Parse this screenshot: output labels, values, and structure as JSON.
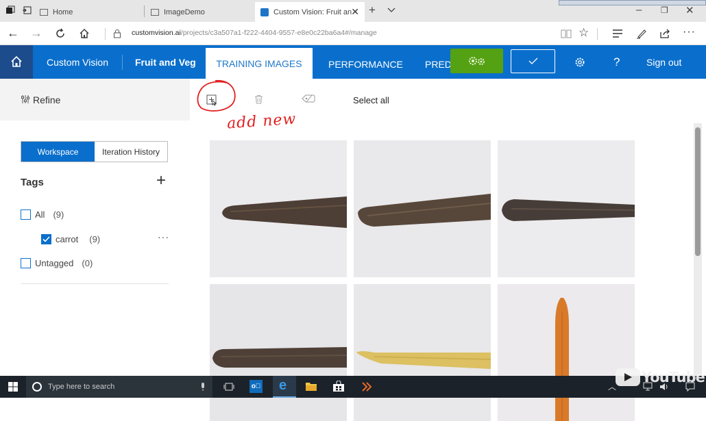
{
  "browser": {
    "tabs": [
      {
        "label": "Home",
        "active": false
      },
      {
        "label": "ImageDemo",
        "active": false
      },
      {
        "label": "Custom Vision: Fruit an",
        "active": true
      }
    ],
    "url_host": "customvision.ai",
    "url_path": "/projects/c3a507a1-f222-4404-9557-e8e0c22ba6a4#/manage"
  },
  "header": {
    "app_name": "Custom Vision",
    "project_name": "Fruit and Veg",
    "tabs": [
      "TRAINING IMAGES",
      "PERFORMANCE",
      "PREDI"
    ],
    "sign_out": "Sign out",
    "accent": "#0a6fcc",
    "train_color": "#55a114"
  },
  "sidebar": {
    "refine_label": "Refine",
    "seg_workspace": "Workspace",
    "seg_history": "Iteration History",
    "tags_title": "Tags",
    "tags": [
      {
        "label": "All",
        "count": "(9)",
        "checked": false
      },
      {
        "label": "carrot",
        "count": "(9)",
        "checked": true
      },
      {
        "label": "Untagged",
        "count": "(0)",
        "checked": false
      }
    ]
  },
  "toolbar": {
    "select_all": "Select all",
    "icons": [
      "add-images-icon",
      "trash-icon",
      "tag-icon"
    ]
  },
  "annotation": {
    "handwritten": "add new"
  },
  "images": [
    {
      "kind": "dark carrot"
    },
    {
      "kind": "dark carrot"
    },
    {
      "kind": "dark carrot"
    },
    {
      "kind": "dark carrot"
    },
    {
      "kind": "yellow carrot"
    },
    {
      "kind": "orange carrot"
    }
  ],
  "taskbar": {
    "search_placeholder": "Type here to search",
    "youtube": "YouTube"
  }
}
